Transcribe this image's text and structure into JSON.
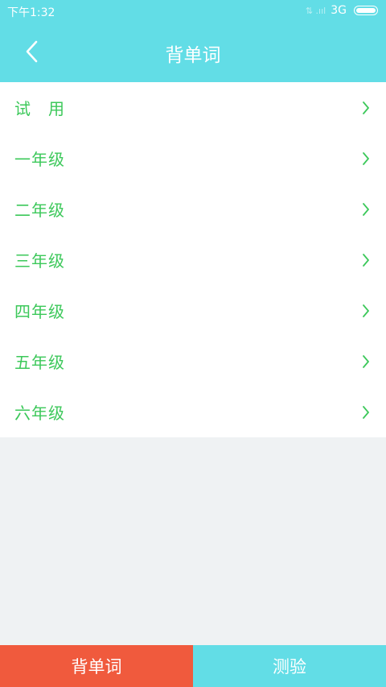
{
  "statusbar": {
    "time": "下午1:32",
    "signal": "⇅ .ııl",
    "network": "3G"
  },
  "header": {
    "title": "背单词",
    "back_icon": "chevron-left-icon"
  },
  "list": {
    "items": [
      {
        "label": "试　用"
      },
      {
        "label": "一年级"
      },
      {
        "label": "二年级"
      },
      {
        "label": "三年级"
      },
      {
        "label": "四年级"
      },
      {
        "label": "五年级"
      },
      {
        "label": "六年级"
      }
    ],
    "chevron_icon": "chevron-right-icon"
  },
  "tabs": [
    {
      "label": "背单词",
      "active": true
    },
    {
      "label": "测验",
      "active": false
    }
  ],
  "colors": {
    "primary": "#62dde6",
    "accent": "#f05a3d",
    "text_green": "#3cc85a",
    "background": "#eff2f3"
  }
}
